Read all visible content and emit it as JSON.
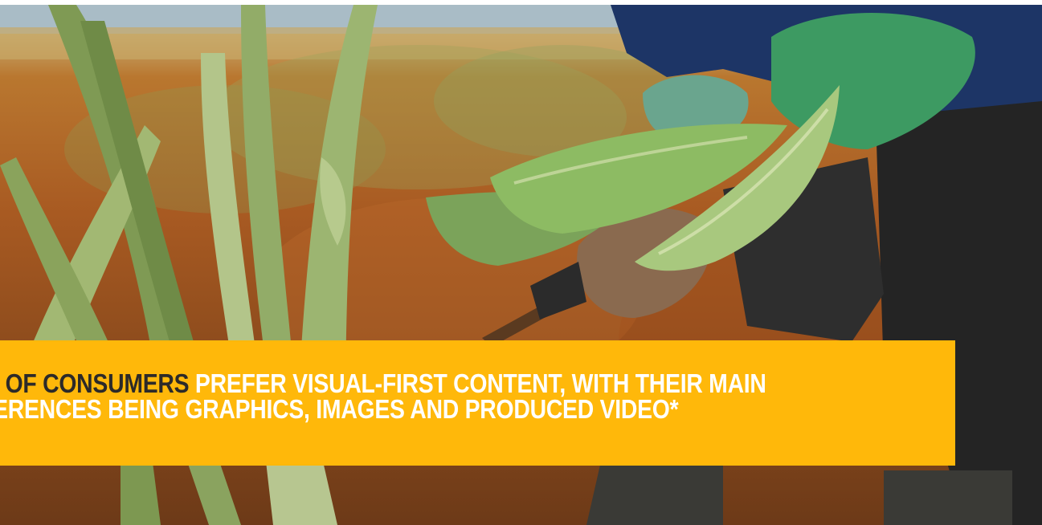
{
  "banner": {
    "line1_accent": "% OF CONSUMERS",
    "line1_rest": " PREFER VISUAL-FIRST CONTENT, WITH THEIR MAIN",
    "line2": "FERENCES BEING GRAPHICS, IMAGES AND PRODUCED VIDEO*"
  },
  "colors": {
    "banner_background": "#ffb80a",
    "banner_text": "#ffffff",
    "banner_accent_text": "#2c2a29"
  },
  "photo": {
    "subject": "aloe-vera-harvest-photo"
  }
}
